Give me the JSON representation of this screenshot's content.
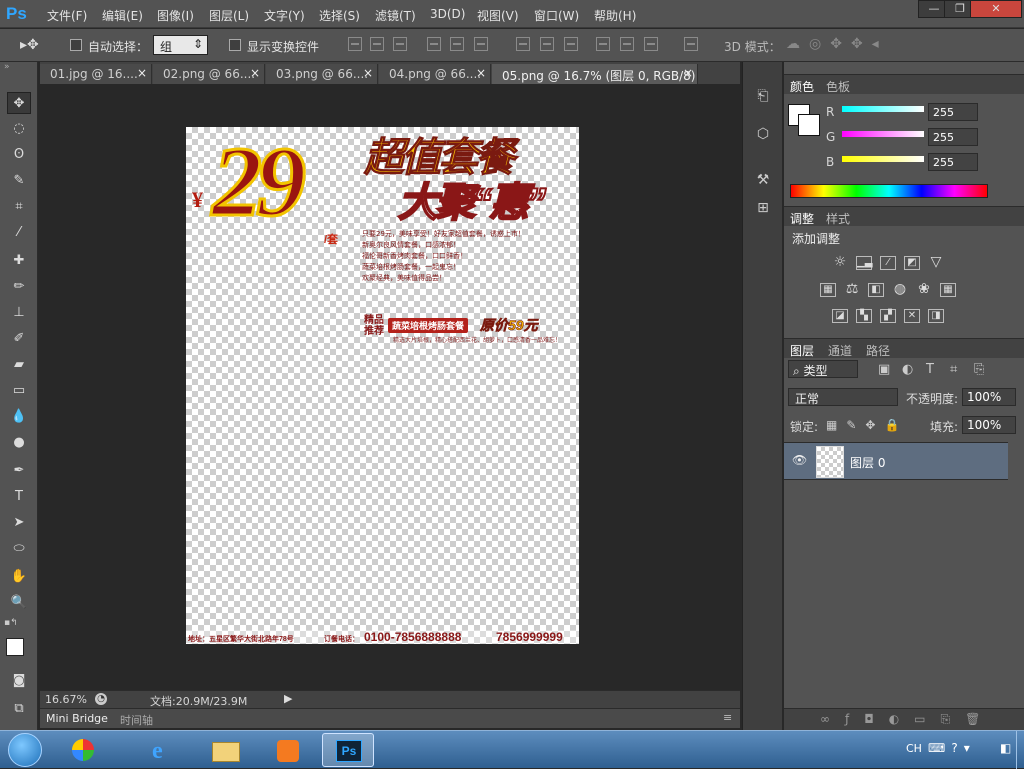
{
  "app": {
    "logo": "Ps"
  },
  "menu": [
    "文件(F)",
    "编辑(E)",
    "图像(I)",
    "图层(L)",
    "文字(Y)",
    "选择(S)",
    "滤镜(T)",
    "3D(D)",
    "视图(V)",
    "窗口(W)",
    "帮助(H)"
  ],
  "window_controls": {
    "minimize": "—",
    "restore": "❐",
    "close": "✕"
  },
  "options": {
    "auto_select_label": "自动选择：",
    "auto_select_value": "组",
    "show_transform_label": "显示变换控件",
    "mode3d_label": "3D 模式："
  },
  "tabs": [
    {
      "label": "01.jpg @ 16....",
      "close": "×"
    },
    {
      "label": "02.png @ 66....",
      "close": "×"
    },
    {
      "label": "03.png @ 66....",
      "close": "×"
    },
    {
      "label": "04.png @ 66....",
      "close": "×"
    },
    {
      "label": "05.png @ 16.7% (图层 0, RGB/8)",
      "close": "×"
    }
  ],
  "poster": {
    "price_currency": "¥",
    "price": "29",
    "price_unit": "/套",
    "headline1": "超值套餐",
    "headline2": "大聚“惠”",
    "desc": [
      "只要29元，美味享受！好友家超值套餐，诱惑上市！",
      "新奥尔良风情套餐，口感浓郁！",
      "福伦哥新香烤肉套餐，口口鲜香！",
      "蔬菜培根烤肠套餐，一起鬼忘！",
      "欢聚经典，美味值得品尝！"
    ],
    "recommend_tag": "精品推荐",
    "recommend_item": "蔬菜培根烤肠套餐",
    "original_price": "原价59元",
    "recommend_desc": "精选大片培根，精心搭配西兰花、胡萝卜，口感清香一品难忘！",
    "address": "地址：五星区繁华大街北路年78号",
    "phone_label": "订餐电话：",
    "phone1": "0100-7856888888",
    "phone2": "7856999999"
  },
  "status": {
    "zoom": "16.67%",
    "doc": "文档:20.9M/23.9M"
  },
  "mini": {
    "bridge": "Mini Bridge",
    "timeline": "时间轴"
  },
  "color_panel": {
    "tabs": [
      "颜色",
      "色板"
    ],
    "channels": [
      {
        "label": "R",
        "value": "255",
        "color": "#00ffff"
      },
      {
        "label": "G",
        "value": "255",
        "color": "#ff00ff"
      },
      {
        "label": "B",
        "value": "255",
        "color": "#ffff00"
      }
    ]
  },
  "adjust_panel": {
    "tabs": [
      "调整",
      "样式"
    ],
    "title": "添加调整"
  },
  "layers_panel": {
    "tabs": [
      "图层",
      "通道",
      "路径"
    ],
    "filter_label": "类型",
    "blend_mode": "正常",
    "opacity_label": "不透明度:",
    "opacity_value": "100%",
    "lock_label": "锁定:",
    "fill_label": "填充:",
    "fill_value": "100%",
    "layer_name": "图层 0"
  },
  "taskbar": {
    "tray_lang": "CH"
  }
}
